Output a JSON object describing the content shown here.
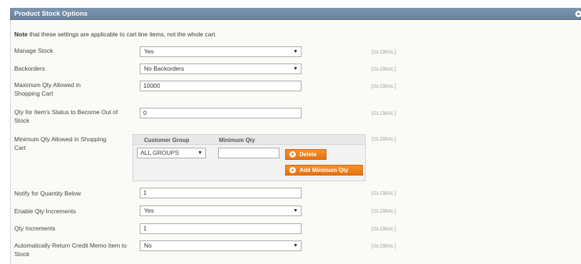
{
  "section": {
    "title": "Product Stock Options",
    "collapse_icon": "collapse-icon"
  },
  "note": {
    "bold": "Note",
    "text": " that these settings are applicable to cart line items, not the whole cart."
  },
  "scope_label": "[GLOBAL]",
  "fields": {
    "manage_stock": {
      "label": "Manage Stock",
      "value": "Yes"
    },
    "backorders": {
      "label": "Backorders",
      "value": "No Backorders"
    },
    "max_qty": {
      "label": "Maximum Qty Allowed in Shopping Cart",
      "value": "10000"
    },
    "out_of_stock_qty": {
      "label": "Qty for Item's Status to Become Out of Stock",
      "value": "0"
    },
    "min_qty": {
      "label": "Minimum Qty Allowed in Shopping Cart",
      "columns": [
        "Customer Group",
        "Minimum Qty"
      ],
      "customer_group": "ALL GROUPS",
      "minimum_qty": "",
      "delete_label": "Delete",
      "add_label": "Add Minimum Qty"
    },
    "notify_qty_below": {
      "label": "Notify for Quantity Below",
      "value": "1"
    },
    "enable_qty_increments": {
      "label": "Enable Qty Increments",
      "value": "Yes"
    },
    "qty_increments": {
      "label": "Qty Increments",
      "value": "1"
    },
    "auto_return": {
      "label": "Automatically Return Credit Memo Item to Stock",
      "value": "No"
    }
  }
}
